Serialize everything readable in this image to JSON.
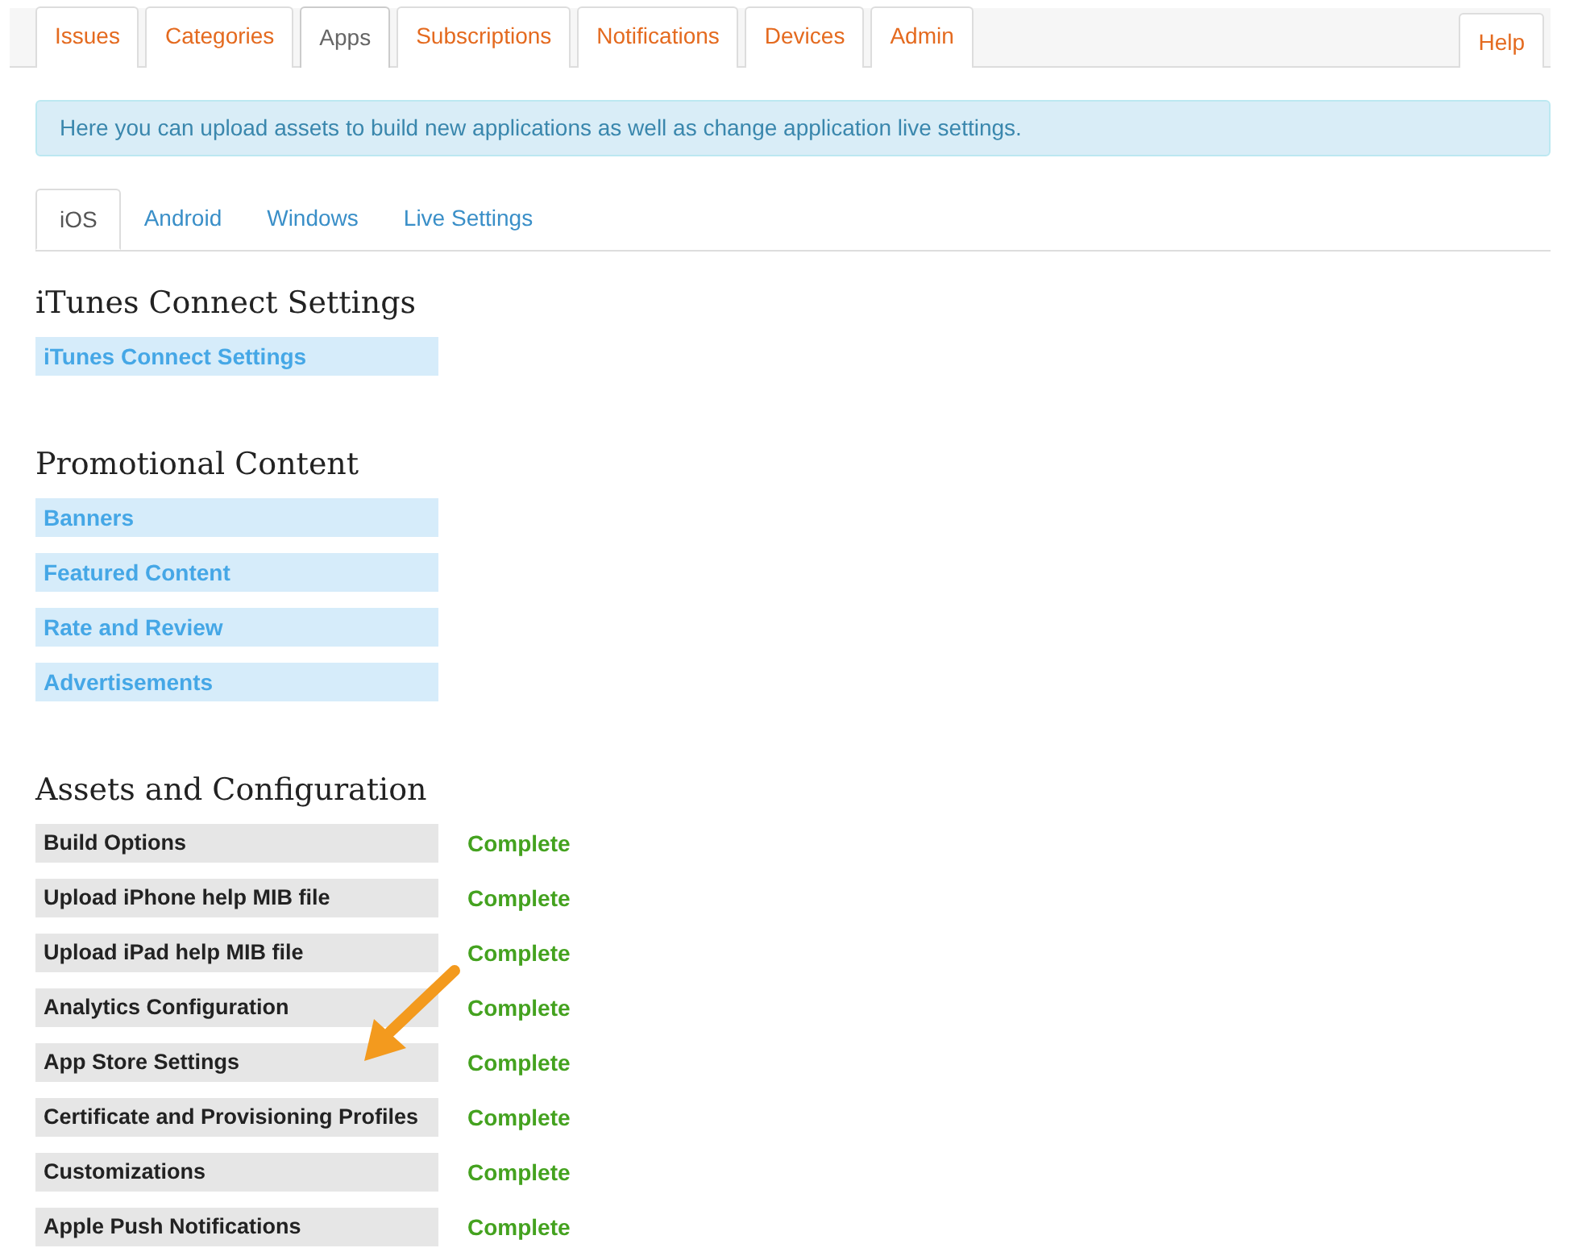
{
  "main_tabs": [
    {
      "label": "Issues",
      "selected": false
    },
    {
      "label": "Categories",
      "selected": false
    },
    {
      "label": "Apps",
      "selected": true
    },
    {
      "label": "Subscriptions",
      "selected": false
    },
    {
      "label": "Notifications",
      "selected": false
    },
    {
      "label": "Devices",
      "selected": false
    },
    {
      "label": "Admin",
      "selected": false
    }
  ],
  "help_tab": {
    "label": "Help",
    "selected": false
  },
  "info_alert": "Here you can upload assets to build new applications as well as change application live settings.",
  "platform_tabs": [
    {
      "label": "iOS",
      "selected": true
    },
    {
      "label": "Android",
      "selected": false
    },
    {
      "label": "Windows",
      "selected": false
    },
    {
      "label": "Live Settings",
      "selected": false
    }
  ],
  "sections": [
    {
      "title": "iTunes Connect Settings",
      "kind": "links",
      "items": [
        {
          "label": "iTunes Connect Settings"
        }
      ]
    },
    {
      "title": "Promotional Content",
      "kind": "links",
      "items": [
        {
          "label": "Banners"
        },
        {
          "label": "Featured Content"
        },
        {
          "label": "Rate and Review"
        },
        {
          "label": "Advertisements"
        }
      ]
    },
    {
      "title": "Assets and Configuration",
      "kind": "tasks",
      "items": [
        {
          "label": "Build Options",
          "status": "Complete"
        },
        {
          "label": "Upload iPhone help MIB file",
          "status": "Complete"
        },
        {
          "label": "Upload iPad help MIB file",
          "status": "Complete"
        },
        {
          "label": "Analytics Configuration",
          "status": "Complete"
        },
        {
          "label": "App Store Settings",
          "status": "Complete"
        },
        {
          "label": "Certificate and Provisioning Profiles",
          "status": "Complete"
        },
        {
          "label": "Customizations",
          "status": "Complete"
        },
        {
          "label": "Apple Push Notifications",
          "status": "Complete"
        }
      ]
    }
  ]
}
